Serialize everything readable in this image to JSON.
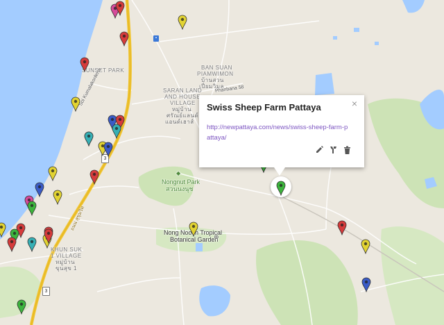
{
  "labels": {
    "sunset_park": "SUNSET PARK",
    "ban_suan_1": "BAN SUAN",
    "ban_suan_2": "PIAMWIMON",
    "ban_suan_thai_1": "บ้านสวน",
    "ban_suan_thai_2": "เปี่ยมวิมล",
    "saran_1": "SARAN LAND",
    "saran_2": "AND HOUSE",
    "saran_3": "VILLAGE",
    "saran_thai_1": "หมู่บ้าน",
    "saran_thai_2": "ศรัณย์แลนด์",
    "saran_thai_3": "แอนด์เฮาส์",
    "nongnut_1": "Nongnut Park",
    "nongnut_2": "สวนนงนุช",
    "nong_nooch_1": "Nong Nooch Tropical",
    "nong_nooch_2": "Botanical Garden",
    "khun_suk_1": "KHUN SUK",
    "khun_suk_2": "1 VILLAGE",
    "khun_suk_thai_1": "หมู่บ้าน",
    "khun_suk_thai_2": "ขุนสุข 1",
    "sukhumvit_thai": "ถนน สุขุมวิท",
    "soi_kamala": "Soi Kumalakonlena",
    "phanbana": "Phanbana 58",
    "route_3_a": "3",
    "route_3_b": "3",
    "bus_a": "□"
  },
  "popup": {
    "title": "Swiss Sheep Farm Pattaya",
    "link": "http://newpattaya.com/news/swiss-sheep-farm-pattaya/",
    "close": "×"
  },
  "pins": [
    {
      "color": "#d64a9a"
    },
    {
      "color": "#d63b3b"
    },
    {
      "color": "#e2d332"
    },
    {
      "color": "#d63b3b"
    },
    {
      "color": "#d63b3b"
    },
    {
      "color": "#e2d332"
    },
    {
      "color": "#3a5bc7"
    },
    {
      "color": "#d63b3b"
    },
    {
      "color": "#36b0b5"
    },
    {
      "color": "#36b0b5"
    },
    {
      "color": "#e2d332"
    },
    {
      "color": "#3a5bc7"
    },
    {
      "color": "#36b0b5"
    },
    {
      "color": "#e2d332"
    },
    {
      "color": "#d63b3b"
    },
    {
      "color": "#3a5bc7"
    },
    {
      "color": "#e2d332"
    },
    {
      "color": "#d64a9a"
    },
    {
      "color": "#3cb53c"
    },
    {
      "color": "#e2d332"
    },
    {
      "color": "#d63b3b"
    },
    {
      "color": "#3cb53c"
    },
    {
      "color": "#d63b3b"
    },
    {
      "color": "#d63b3b"
    },
    {
      "color": "#e2d332"
    },
    {
      "color": "#36b0b5"
    },
    {
      "color": "#d63b3b"
    },
    {
      "color": "#3cb53c"
    },
    {
      "color": "#e2d332"
    },
    {
      "color": "#3cb53c"
    },
    {
      "color": "#d63b3b"
    },
    {
      "color": "#e2d332"
    },
    {
      "color": "#3a5bc7"
    },
    {
      "color": "#3cb53c"
    }
  ],
  "selected_pin": {
    "color": "#3cb53c"
  },
  "icons": {
    "edit": "pencil-icon",
    "style": "paint-brush-icon",
    "delete": "trash-icon"
  }
}
